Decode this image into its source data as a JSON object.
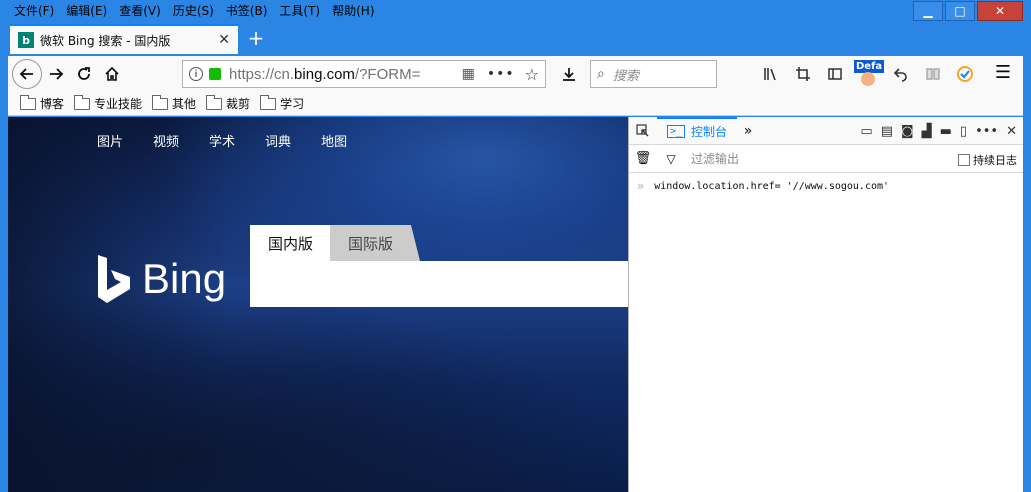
{
  "menubar": {
    "items": [
      "文件(F)",
      "编辑(E)",
      "查看(V)",
      "历史(S)",
      "书签(B)",
      "工具(T)",
      "帮助(H)"
    ]
  },
  "window_controls": {
    "minimize": "▁",
    "maximize": "□",
    "close": "✕"
  },
  "tab": {
    "favicon": "b",
    "title": "微软 Bing 搜索 - 国内版",
    "close": "✕",
    "new_tab": "+"
  },
  "navbar": {
    "url_prefix": "https://cn.",
    "url_domain": "bing.com",
    "url_suffix": "/?FORM=",
    "search_placeholder": "搜索",
    "more_dots": "•••",
    "extension_badge": "Defa"
  },
  "bookmarks": [
    "博客",
    "专业技能",
    "其他",
    "裁剪",
    "学习"
  ],
  "bing": {
    "nav": [
      "图片",
      "视频",
      "学术",
      "词典",
      "地图"
    ],
    "logo_text": "Bing",
    "search_tabs": [
      "国内版",
      "国际版"
    ]
  },
  "devtools": {
    "console_tab": "控制台",
    "filter_placeholder": "过滤输出",
    "persist_logs": "持续日志",
    "console_line": "window.location.href= '//www.sogou.com'",
    "console_prompt": "»"
  },
  "colors": {
    "accent": "#0a84ff",
    "window_frame": "#2b85e4",
    "bing_teal": "#008373",
    "lock_green": "#12bc00"
  }
}
